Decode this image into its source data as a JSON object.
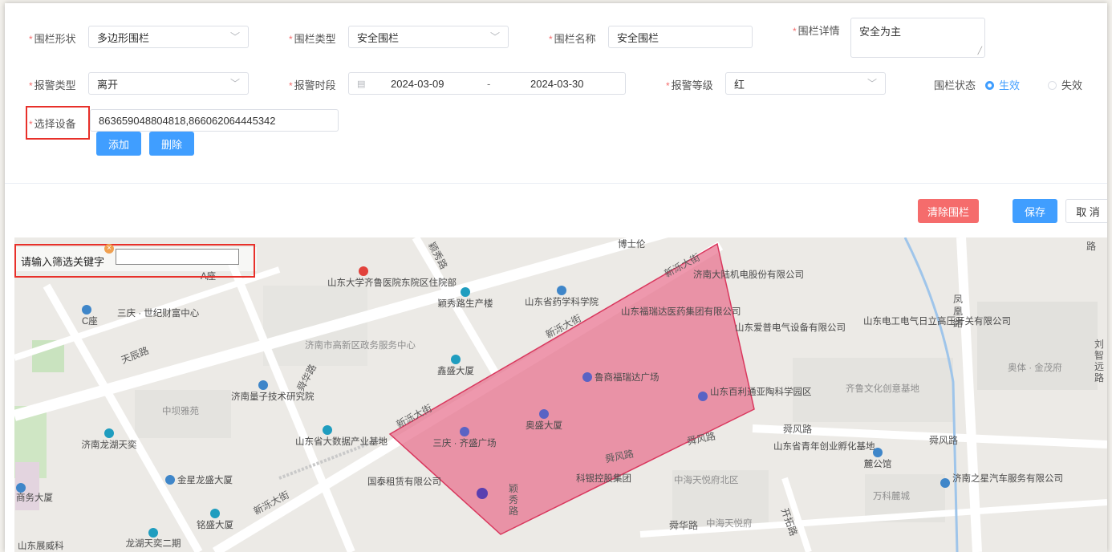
{
  "form": {
    "shape_label": "围栏形状",
    "shape_value": "多边形围栏",
    "type_label": "围栏类型",
    "type_value": "安全围栏",
    "name_label": "围栏名称",
    "name_value": "安全围栏",
    "detail_label": "围栏详情",
    "detail_value": "安全为主",
    "alarm_type_label": "报警类型",
    "alarm_type_value": "离开",
    "alarm_period_label": "报警时段",
    "date_start": "2024-03-09",
    "date_sep": "-",
    "date_end": "2024-03-30",
    "alarm_level_label": "报警等级",
    "alarm_level_value": "红",
    "status_label": "围栏状态",
    "status_active": "生效",
    "status_inactive": "失效",
    "device_label": "选择设备",
    "device_value": "863659048804818,866062064445342",
    "add_label": "添加",
    "delete_label": "删除",
    "required_mark": "*"
  },
  "actions": {
    "clear_label": "清除围栏",
    "save_label": "保存",
    "cancel_label": "取 消"
  },
  "map": {
    "search_label": "请输入筛选关键字",
    "search_value": "",
    "labels": {
      "hospital": "山东大学齐鲁医院东院区住院部",
      "a_building": "A座",
      "c_building": "C座",
      "sanqing_world": "三庆 · 世纪财富中心",
      "tianchen_road": "天辰路",
      "jinan_gov": "济南市高新区政务服务中心",
      "yingxiu_building": "颖秀路生产楼",
      "academy": "山东省药学科学院",
      "xinsheng": "鑫盛大厦",
      "shunhua_road": "舜华路",
      "quantum": "济南量子技术研究院",
      "zhongkun": "中坝雅苑",
      "longhu": "济南龙湖天奕",
      "bigdata": "山东省大数据产业基地",
      "jinxing": "金星龙盛大厦",
      "business": "商务大厦",
      "mingsheng": "铭盛大厦",
      "longhu2": "龙湖天奕二期",
      "exhibition": "山东展威科",
      "xinluo_street": "新泺大街",
      "guotai": "国泰租赁有限公司",
      "sanqing_qisheng": "三庆 · 齐盛广场",
      "aosheng": "奥盛大厦",
      "lushang": "鲁商福瑞达广场",
      "fuleida": "山东福瑞达医药集团有限公司",
      "jinan_dalu": "济南大陆机电股份有限公司",
      "aipu": "山东爱普电气设备有限公司",
      "baili": "山东百利通亚陶科学园区",
      "shunfeng_road": "舜风路",
      "kejin": "科银控股集团",
      "zhonghai_north": "中海天悦府北区",
      "zhonghai": "中海天悦府",
      "youth": "山东省青年创业孵化基地",
      "li_library": "麓公馆",
      "wanke": "万科麓城",
      "qilu_culture": "齐鲁文化创意基地",
      "electric": "山东电工电气日立高压开关有限公司",
      "aoti": "奥体 · 金茂府",
      "jinan_star": "济南之星汽车服务有限公司",
      "fenghuang_road": "凤凰路",
      "liuzhiyuan_road": "刘智远路",
      "kaituo_road": "开拓路",
      "yingxiu_road": "颖秀路",
      "boshi": "博士伦",
      "road_top": "路"
    }
  },
  "colors": {
    "primary": "#409eff",
    "danger": "#f56c6c",
    "fence_fill": "#e8708e",
    "fence_stroke": "#d9385e",
    "highlight": "#e8302a"
  }
}
